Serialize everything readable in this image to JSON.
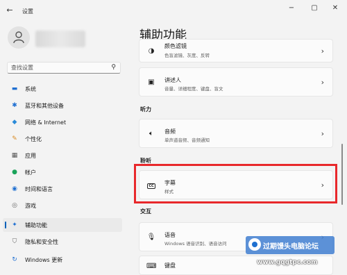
{
  "window": {
    "title": "设置"
  },
  "sidebar": {
    "search_placeholder": "查找设置",
    "items": [
      {
        "label": "系统",
        "icon": "monitor-icon",
        "color": "#1f6fd1"
      },
      {
        "label": "蓝牙和其他设备",
        "icon": "bluetooth-icon",
        "color": "#1f6fd1"
      },
      {
        "label": "网络 & Internet",
        "icon": "wifi-icon",
        "color": "#2a8ad8"
      },
      {
        "label": "个性化",
        "icon": "brush-icon",
        "color": "#d98a23"
      },
      {
        "label": "应用",
        "icon": "apps-icon",
        "color": "#555555"
      },
      {
        "label": "帐户",
        "icon": "person-icon",
        "color": "#1aa35a"
      },
      {
        "label": "时间和语言",
        "icon": "globe-clock-icon",
        "color": "#1f6fd1"
      },
      {
        "label": "游戏",
        "icon": "gamepad-icon",
        "color": "#666666"
      },
      {
        "label": "辅助功能",
        "icon": "accessibility-icon",
        "color": "#1f6fd1",
        "active": true
      },
      {
        "label": "隐私和安全性",
        "icon": "shield-icon",
        "color": "#666666"
      },
      {
        "label": "Windows 更新",
        "icon": "update-icon",
        "color": "#1f6fd1"
      }
    ]
  },
  "main": {
    "title": "辅助功能",
    "cards": {
      "color_filter": {
        "title": "颜色滤镜",
        "subtitle": "色盲滤镜、灰度、反转"
      },
      "narrator": {
        "title": "讲述人",
        "subtitle": "音量、详细程度、键盘、盲文"
      },
      "audio": {
        "title": "音频",
        "subtitle": "单声道音频、音频通知"
      },
      "captions": {
        "title": "字幕",
        "subtitle": "样式"
      },
      "speech": {
        "title": "语音",
        "subtitle": "Windows 语音识别、语音访问"
      },
      "keyboard": {
        "title": "键盘",
        "subtitle": ""
      }
    },
    "sections": {
      "hearing": "听力",
      "hearing2": "聆听",
      "interaction": "交互"
    }
  },
  "watermark": {
    "text": "过期馒头电脑论坛",
    "url": "www.gqgtpc.com"
  },
  "accent_color": "#005fb8",
  "highlight_color": "#e8282b"
}
